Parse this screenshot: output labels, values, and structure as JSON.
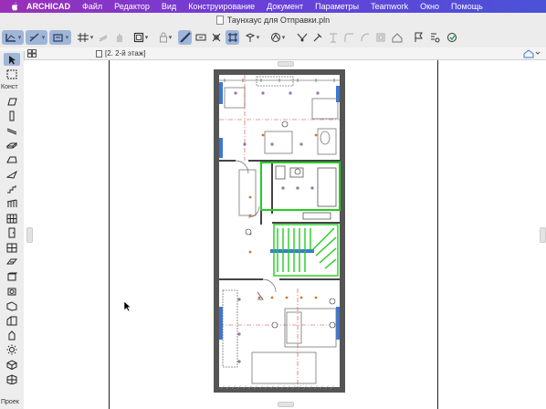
{
  "menubar": {
    "app": "ARCHICAD",
    "items": [
      "Файл",
      "Редактор",
      "Вид",
      "Конструирование",
      "Документ",
      "Параметры",
      "Teamwork",
      "Окно",
      "Помощь"
    ]
  },
  "window": {
    "title": "Таунхаус для Отправки.pln"
  },
  "tab": {
    "label": "[2. 2-й этаж]"
  },
  "toolbox": {
    "section_construct": "Конст",
    "section_document": "Проек"
  },
  "colors": {
    "menubar_gradient_start": "#9b2fb8",
    "menubar_gradient_end": "#4a52d8",
    "selected_tool": "#9fb6d8",
    "highlight_green": "#22cc22",
    "highlight_blue": "#3a78d8",
    "grid_red": "#d23c3c",
    "wall_fill": "#555555"
  }
}
